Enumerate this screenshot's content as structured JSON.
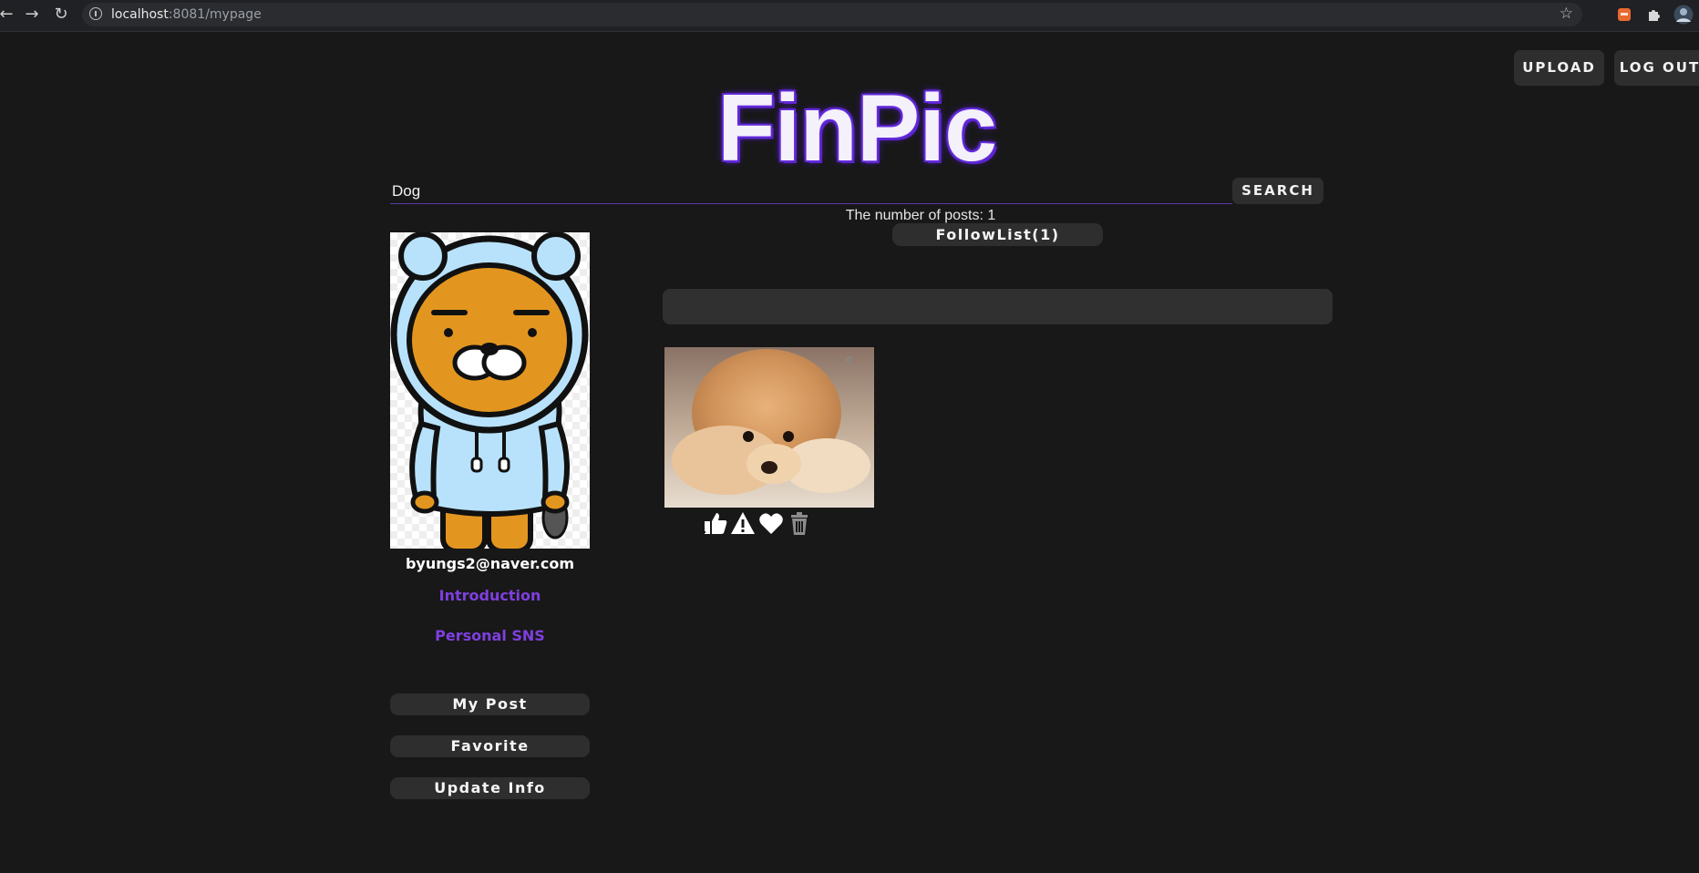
{
  "browser": {
    "url_host": "localhost",
    "url_path": ":8081/mypage"
  },
  "header": {
    "upload_label": "UPLOAD",
    "logout_label": "LOG OUT",
    "logo_text": "FinPic"
  },
  "search": {
    "value": "Dog",
    "button_label": "SEARCH"
  },
  "post_count_text": "The number of posts: 1",
  "follow_list_label": "FollowList(1)",
  "profile": {
    "email": "byungs2@naver.com",
    "introduction_label": "Introduction",
    "sns_label": "Personal SNS"
  },
  "sidebar": {
    "my_post_label": "My Post",
    "favorite_label": "Favorite",
    "update_info_label": "Update Info"
  },
  "posts": [
    {
      "image": "fluffy-pomeranian-dog",
      "actions": [
        "thumbs-up-icon",
        "warning-icon",
        "heart-icon",
        "trash-icon"
      ]
    }
  ],
  "colors": {
    "background": "#181818",
    "accent": "#7f3fe0",
    "button_bg": "#2e2e2e"
  }
}
